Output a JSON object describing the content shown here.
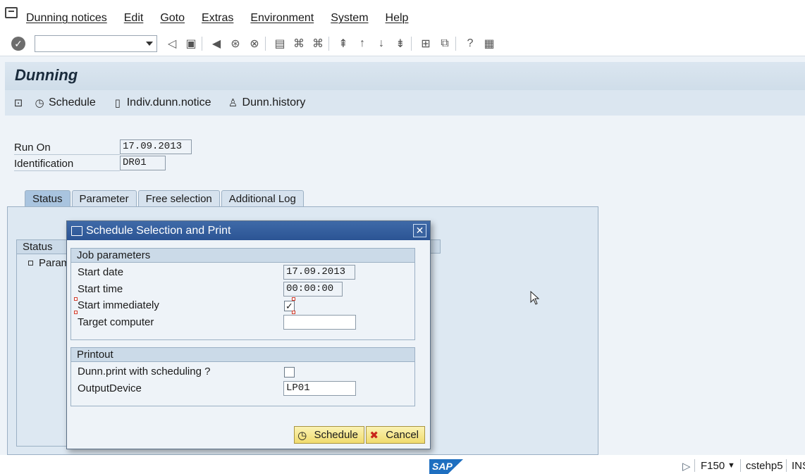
{
  "menu": {
    "items": [
      "Dunning notices",
      "Edit",
      "Goto",
      "Extras",
      "Environment",
      "System",
      "Help"
    ]
  },
  "toolbar": {
    "command_field": "",
    "icons": [
      "enter-icon",
      "back-icon",
      "save-icon",
      "back-nav-icon",
      "exit-icon",
      "cancel-icon",
      "print-icon",
      "find-icon",
      "find-next-icon",
      "first-page-icon",
      "prev-page-icon",
      "next-page-icon",
      "last-page-icon",
      "new-session-icon",
      "shortcut-icon",
      "help-icon",
      "layout-icon"
    ]
  },
  "title": "Dunning",
  "app_toolbar": {
    "schedule": "Schedule",
    "indiv": "Indiv.dunn.notice",
    "history": "Dunn.history"
  },
  "header_fields": {
    "run_on_label": "Run On",
    "run_on_value": "17.09.2013",
    "identification_label": "Identification",
    "identification_value": "DR01"
  },
  "tabs": [
    "Status",
    "Parameter",
    "Free selection",
    "Additional Log"
  ],
  "status_panel": {
    "header": "Status",
    "item": "Param"
  },
  "dialog": {
    "title": "Schedule Selection and Print",
    "job_group": {
      "header": "Job parameters",
      "start_date_label": "Start date",
      "start_date_value": "17.09.2013",
      "start_time_label": "Start time",
      "start_time_value": "00:00:00",
      "start_immediately_label": "Start immediately",
      "start_immediately_checked": "✓",
      "target_computer_label": "Target computer",
      "target_computer_value": ""
    },
    "print_group": {
      "header": "Printout",
      "dunn_print_label": "Dunn.print with scheduling ?",
      "dunn_print_checked": "",
      "output_device_label": "OutputDevice",
      "output_device_value": "LP01"
    },
    "schedule_button": "Schedule",
    "cancel_button": "Cancel"
  },
  "statusbar": {
    "logo": "SAP",
    "transaction": "F150",
    "server": "cstehp5",
    "mode": "INS"
  }
}
